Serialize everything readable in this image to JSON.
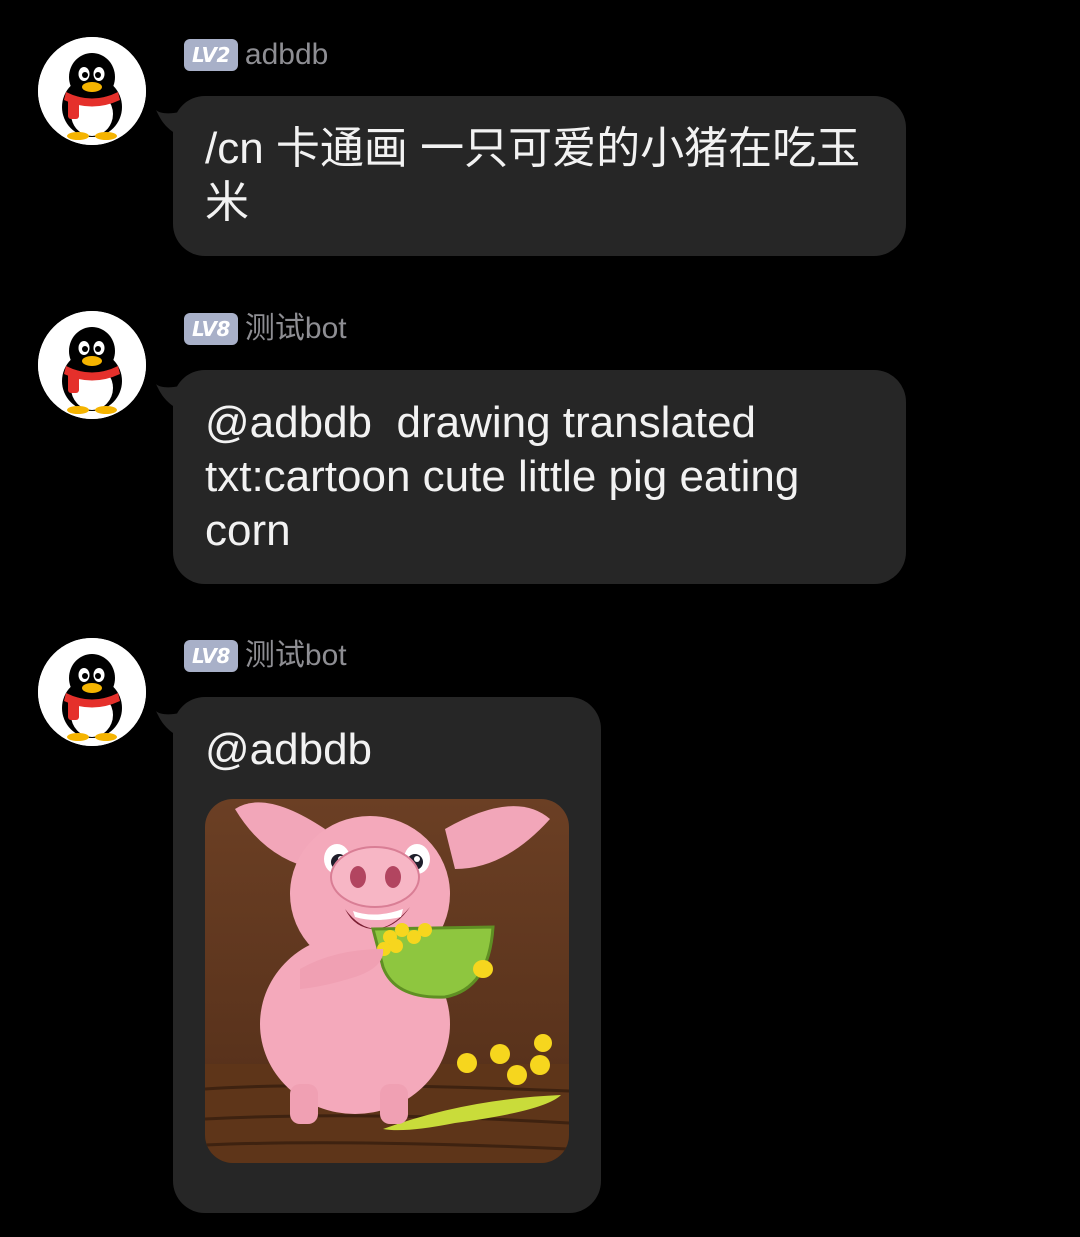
{
  "messages": [
    {
      "avatar_icon": "qq-penguin-avatar-icon",
      "level": "LV2",
      "sender": "adbdb",
      "text": "/cn 卡通画 一只可爱的小猪在吃玉米"
    },
    {
      "avatar_icon": "qq-penguin-avatar-icon",
      "level": "LV8",
      "sender": "测试bot",
      "text": "@adbdb  drawing translated txt:cartoon cute little pig eating corn"
    },
    {
      "avatar_icon": "qq-penguin-avatar-icon",
      "level": "LV8",
      "sender": "测试bot",
      "text": "@adbdb",
      "image_icon": "cartoon-pig-eating-corn-image"
    }
  ],
  "colors": {
    "background": "#000000",
    "bubble": "#262626",
    "text": "#f2f2f2",
    "sender": "#8e8e93",
    "level_badge": "#a8b0c8"
  }
}
